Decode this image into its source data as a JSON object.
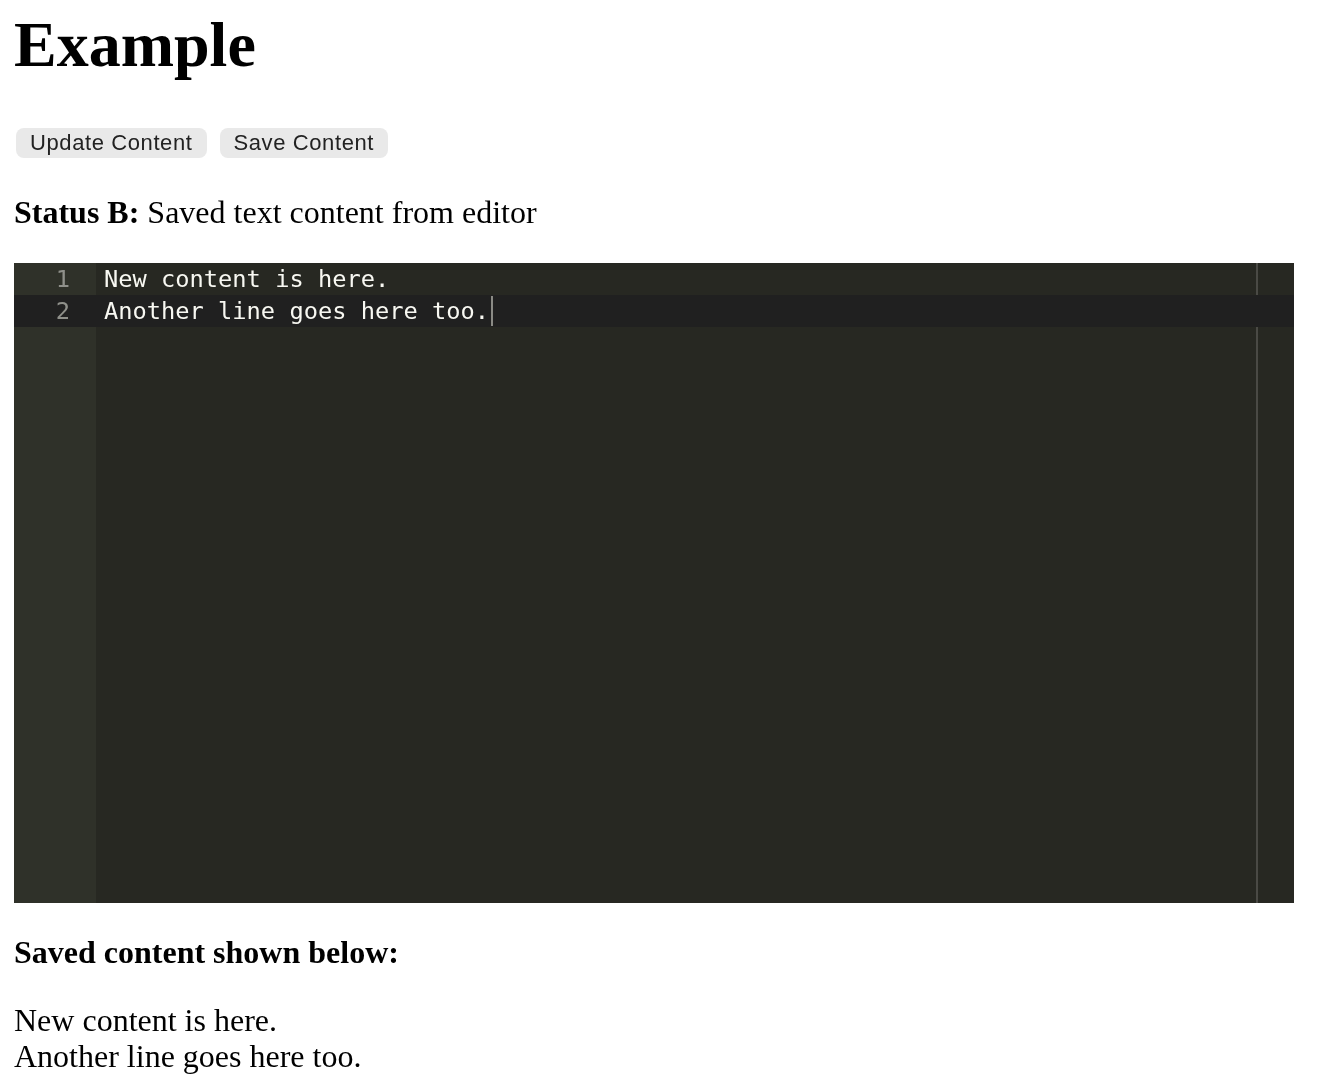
{
  "title": "Example",
  "buttons": [
    {
      "label": "Update Content"
    },
    {
      "label": "Save Content"
    }
  ],
  "status": "**Status B:** Saved text content from editor",
  "editor": {
    "lines": [
      {
        "number": "1",
        "text": "New content is here.",
        "active": false,
        "cursor": false
      },
      {
        "number": "2",
        "text": "Another line goes here too.",
        "active": true,
        "cursor": true
      }
    ]
  },
  "saved": {
    "heading": "Saved content shown below:",
    "lines": [
      "New content is here.",
      "Another line goes here too."
    ]
  }
}
